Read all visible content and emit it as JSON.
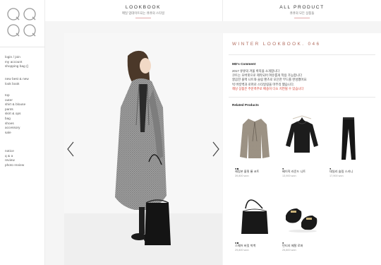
{
  "brand": {
    "logo_text": "QQQQ"
  },
  "sidebar": {
    "account": [
      {
        "label": "login / join"
      },
      {
        "label": "my account"
      },
      {
        "label": "shopping bag ()"
      }
    ],
    "featured": [
      {
        "label": "new best & new"
      },
      {
        "label": "look book"
      }
    ],
    "categories": [
      {
        "label": "top"
      },
      {
        "label": "outer"
      },
      {
        "label": "shirt & blouse"
      },
      {
        "label": "pants"
      },
      {
        "label": "skirt & ops"
      },
      {
        "label": "bag"
      },
      {
        "label": "shoes"
      },
      {
        "label": "accessory"
      },
      {
        "label": "sale"
      }
    ],
    "community": [
      {
        "label": "notice"
      },
      {
        "label": "q & a"
      },
      {
        "label": "review"
      },
      {
        "label": "photo review"
      }
    ]
  },
  "header": {
    "tabs": [
      {
        "title": "LOOKBOOK",
        "subtitle": "매일 업데이트되는 큐큐의 스타일"
      },
      {
        "title": "ALL PRODUCT",
        "subtitle": "큐큐의 모든 상품들"
      }
    ]
  },
  "lookbook": {
    "title": "WINTER LOOKBOOK. 046",
    "md_comment_title": "MD's Comment",
    "md_comment_lines": [
      {
        "text": "2017 큐큐의 겨울 룩북을 소개합니다",
        "highlight": false
      },
      {
        "text": "코트는 오버핏으로 제작되어 여유롭게 착용 가능합니다",
        "highlight": false
      },
      {
        "text": "깔끔한 블랙 니트와 슬림 팬츠로 모던한 무드를 완성했어요",
        "highlight": false
      },
      {
        "text": "빅 버킷백과 로퍼로 스타일링을 마무리 했습니다.",
        "highlight": false
      },
      {
        "text": "해당 상품은 주문폭주로 배송이 다소 지연될 수 있습니다",
        "highlight": true
      }
    ],
    "related_title": "Related Products"
  },
  "products": [
    {
      "name": "헤링본 울핏 롱 코트",
      "price": "39,800 won",
      "colors": "●■",
      "icon": "coat-icon"
    },
    {
      "name": "베이직 라운드 니트",
      "price": "13,900 won",
      "colors": "●",
      "icon": "knit-icon"
    },
    {
      "name": "데일리 슬림 스키니",
      "price": "17,900 won",
      "colors": "●",
      "icon": "pants-icon"
    },
    {
      "name": "스퀘어 버킷 빅백",
      "price": "29,800 won",
      "colors": "●■",
      "icon": "bag-icon"
    },
    {
      "name": "빈티지 메탈 로퍼",
      "price": "25,800 won",
      "colors": "●",
      "icon": "loafer-icon"
    }
  ],
  "carousel": {
    "prev_icon": "chevron-left-icon",
    "next_icon": "chevron-right-icon"
  },
  "colors": {
    "accent": "#b06a5c",
    "highlight": "#d33a2c",
    "tab_bar": "#e0a8a8"
  }
}
